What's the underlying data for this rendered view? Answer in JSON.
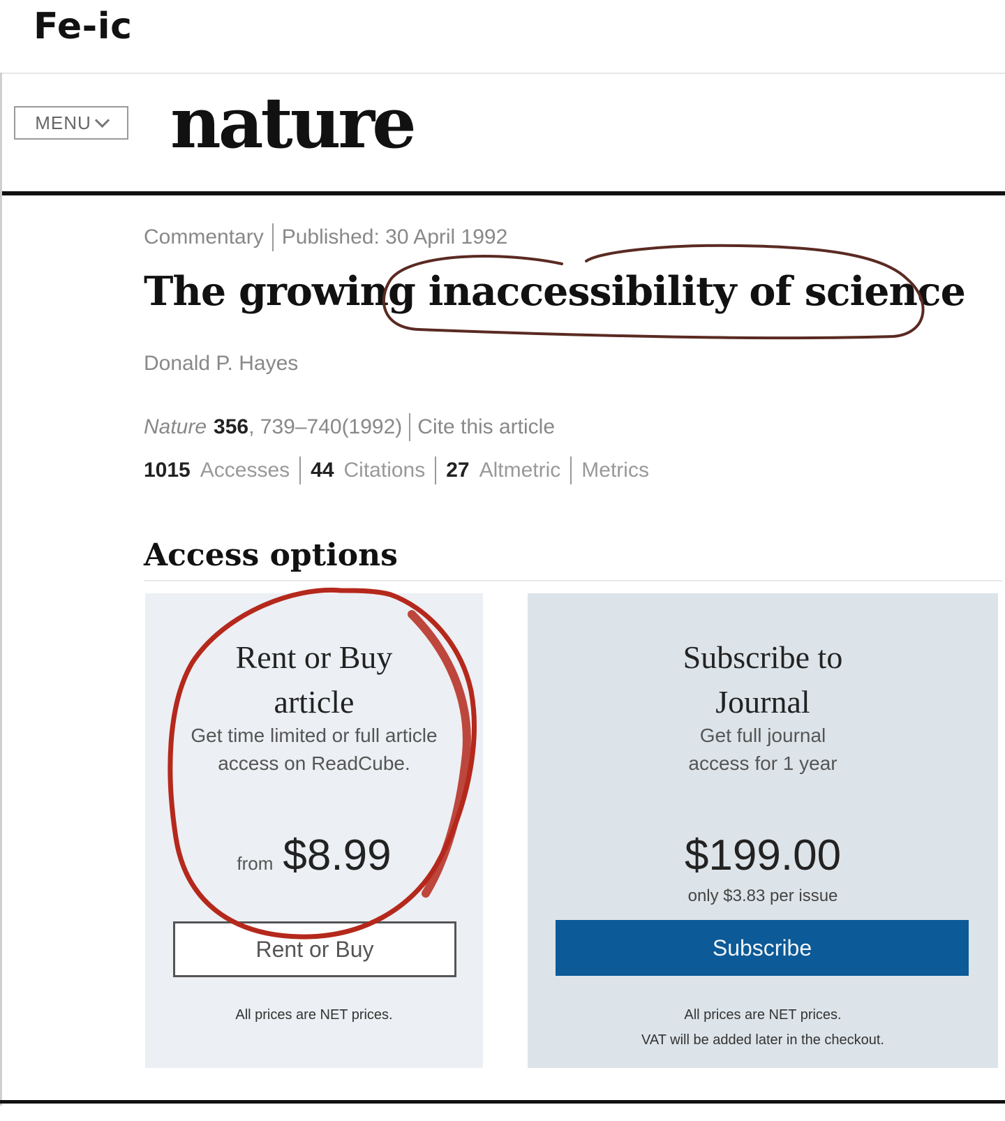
{
  "post": {
    "caption": "Fe-ic"
  },
  "header": {
    "menu_label": "MENU",
    "logo": "nature"
  },
  "article": {
    "type": "Commentary",
    "published": "Published: 30 April 1992",
    "title": "The growing inaccessibility of science",
    "author": "Donald P. Hayes",
    "journal": "Nature",
    "volume": "356",
    "pages": ", 739–740(1992)",
    "cite_link": "Cite this article",
    "stats": {
      "accesses_count": "1015",
      "accesses_label": "Accesses",
      "citations_count": "44",
      "citations_label": "Citations",
      "altmetric_count": "27",
      "altmetric_label": "Altmetric",
      "metrics_link": "Metrics"
    }
  },
  "access": {
    "heading": "Access options",
    "rent": {
      "title_line1": "Rent or Buy",
      "title_line2": "article",
      "desc_line1": "Get time limited or full article",
      "desc_line2": "access on ReadCube.",
      "from": "from",
      "price": "$8.99",
      "button": "Rent or Buy",
      "note": "All prices are NET prices."
    },
    "subscribe": {
      "title_line1": "Subscribe to",
      "title_line2": "Journal",
      "desc_line1": "Get full journal",
      "desc_line2": "access for 1 year",
      "price": "$199.00",
      "per_issue": "only $3.83 per issue",
      "button": "Subscribe",
      "note_line1": "All prices are NET prices.",
      "note_line2": "VAT will be added later in the checkout."
    }
  },
  "colors": {
    "subscribe_button": "#0c5a97",
    "annotation_ink": "#5a2a22",
    "annotation_red": "#b5281c"
  }
}
